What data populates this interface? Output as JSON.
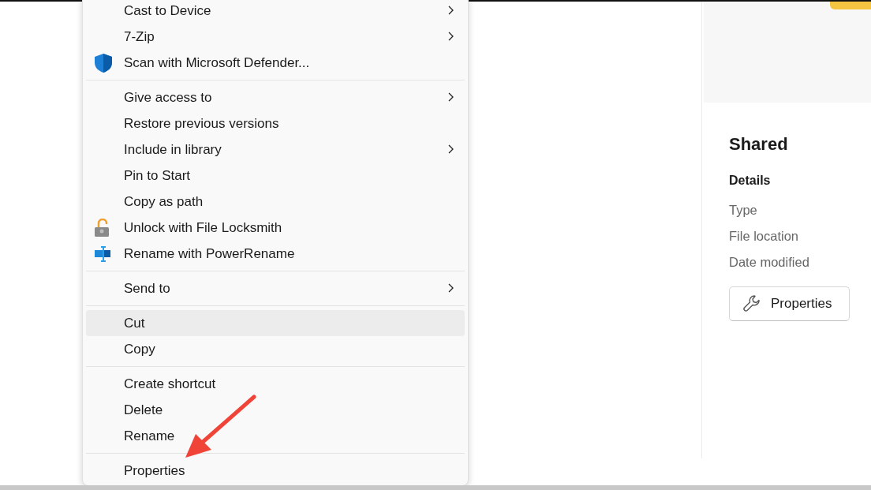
{
  "context_menu": {
    "items": [
      {
        "kind": "item",
        "label": "Cast to Device",
        "submenu": true,
        "selected": false
      },
      {
        "kind": "item",
        "label": "7-Zip",
        "submenu": true,
        "selected": false
      },
      {
        "kind": "shield",
        "label": "Scan with Microsoft Defender...",
        "submenu": false,
        "selected": false
      },
      {
        "kind": "separator"
      },
      {
        "kind": "item",
        "label": "Give access to",
        "submenu": true,
        "selected": false
      },
      {
        "kind": "item",
        "label": "Restore previous versions",
        "submenu": false,
        "selected": false
      },
      {
        "kind": "item",
        "label": "Include in library",
        "submenu": true,
        "selected": false
      },
      {
        "kind": "item",
        "label": "Pin to Start",
        "submenu": false,
        "selected": false
      },
      {
        "kind": "item",
        "label": "Copy as path",
        "submenu": false,
        "selected": false
      },
      {
        "kind": "padlock",
        "label": "Unlock with File Locksmith",
        "submenu": false,
        "selected": false
      },
      {
        "kind": "rename",
        "label": "Rename with PowerRename",
        "submenu": false,
        "selected": false
      },
      {
        "kind": "separator"
      },
      {
        "kind": "item",
        "label": "Send to",
        "submenu": true,
        "selected": false
      },
      {
        "kind": "separator"
      },
      {
        "kind": "item",
        "label": "Cut",
        "submenu": false,
        "selected": true
      },
      {
        "kind": "item",
        "label": "Copy",
        "submenu": false,
        "selected": false
      },
      {
        "kind": "separator"
      },
      {
        "kind": "item",
        "label": "Create shortcut",
        "submenu": false,
        "selected": false
      },
      {
        "kind": "item",
        "label": "Delete",
        "submenu": false,
        "selected": false
      },
      {
        "kind": "item",
        "label": "Rename",
        "submenu": false,
        "selected": false
      },
      {
        "kind": "separator"
      },
      {
        "kind": "item",
        "label": "Properties",
        "submenu": false,
        "selected": false
      }
    ]
  },
  "details_pane": {
    "title": "Shared",
    "section": "Details",
    "fields": [
      "Type",
      "File location",
      "Date modified"
    ],
    "button": "Properties"
  }
}
